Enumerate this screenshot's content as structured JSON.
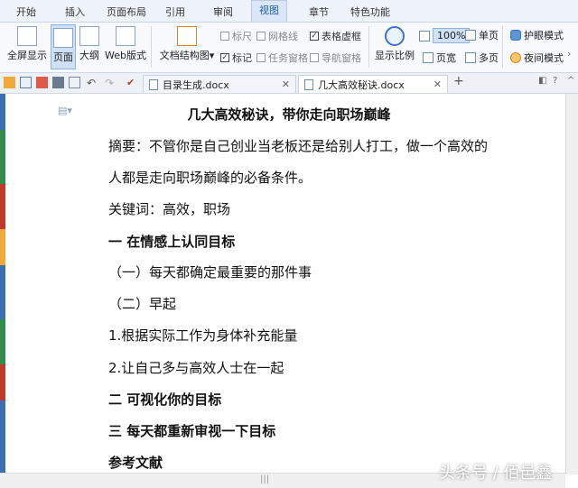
{
  "menu": [
    "开始",
    "插入",
    "页面布局",
    "引用",
    "审阅",
    "视图",
    "章节",
    "特色功能"
  ],
  "active_menu": "视图",
  "ribbon": {
    "fullscreen": "全屏显示",
    "page_view": "页面",
    "outline": "大纲",
    "web_layout": "Web版式",
    "doc_map": "文档结构图",
    "ruler": "标尺",
    "gridlines": "网格线",
    "table_gridlines": "表格虚框",
    "marks": "标记",
    "task_pane": "任务窗格",
    "nav_pane": "导航窗格",
    "zoom_label": "显示比例",
    "zoom_value": "100%",
    "page_width": "页宽",
    "single_page": "单页",
    "multi_page": "多页",
    "eye_mode": "护眼模式",
    "night_mode": "夜间模式"
  },
  "tabs": [
    {
      "title": "目录生成.docx"
    },
    {
      "title": "几大高效秘诀.docx"
    }
  ],
  "document": {
    "title": "几大高效秘诀，带你走向职场巅峰",
    "abstract_1": "摘要：不管你是自己创业当老板还是给别人打工，做一个高效的",
    "abstract_2": "人都是走向职场巅峰的必备条件。",
    "keywords": "关键词：高效，职场",
    "h1": "一  在情感上认同目标",
    "h1_1": "（一）每天都确定最重要的那件事",
    "h1_2": "（二）早起",
    "item_1": "1.根据实际工作为身体补充能量",
    "item_2": "2.让自己多与高效人士在一起",
    "h2": "二  可视化你的目标",
    "h3": "三  每天都重新审视一下目标",
    "refs": "参考文献"
  },
  "watermark": "头条号 / 佰邑鑫",
  "colors": {
    "accent": "#1a5cb0",
    "selected": "#cfe0f7"
  }
}
